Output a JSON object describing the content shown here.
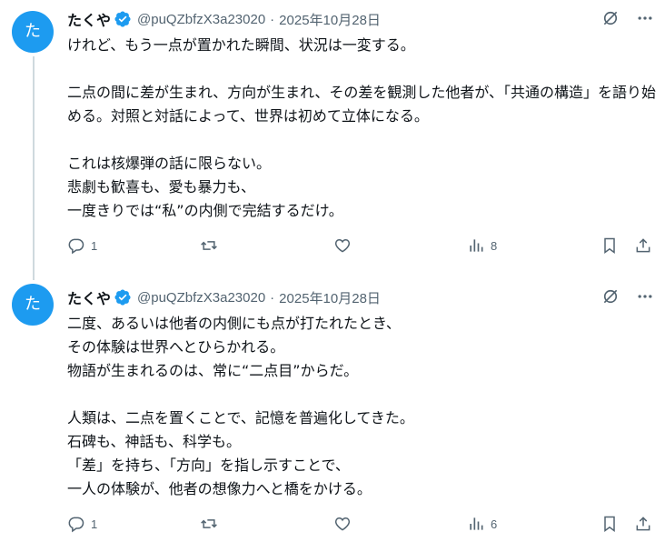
{
  "tweets": [
    {
      "avatar_text": "た",
      "name": "たくや",
      "handle": "@puQZbfzX3a23020",
      "separator": "·",
      "date": "2025年10月28日",
      "text": "けれど、もう一点が置かれた瞬間、状況は一変する。\n\n二点の間に差が生まれ、方向が生まれ、その差を観測した他者が、「共通の構造」を語り始める。対照と対話によって、世界は初めて立体になる。\n\nこれは核爆弾の話に限らない。\n悲劇も歓喜も、愛も暴力も、\n一度きりでは“私”の内側で完結するだけ。",
      "reply_count": "1",
      "views": "8"
    },
    {
      "avatar_text": "た",
      "name": "たくや",
      "handle": "@puQZbfzX3a23020",
      "separator": "·",
      "date": "2025年10月28日",
      "text": "二度、あるいは他者の内側にも点が打たれたとき、\nその体験は世界へとひらかれる。\n物語が生まれるのは、常に“二点目”からだ。\n\n人類は、二点を置くことで、記憶を普遍化してきた。\n石碑も、神話も、科学も。\n「差」を持ち、「方向」を指し示すことで、\n一人の体験が、他者の想像力へと橋をかける。",
      "reply_count": "1",
      "views": "6"
    }
  ],
  "colors": {
    "accent": "#1d9bf0",
    "muted": "#536471",
    "text": "#0f1419",
    "thread_line": "#cfd9de"
  },
  "icons": [
    "verified-badge-icon",
    "grok-icon",
    "more-icon",
    "reply-icon",
    "retweet-icon",
    "like-icon",
    "views-icon",
    "bookmark-icon",
    "share-icon"
  ]
}
